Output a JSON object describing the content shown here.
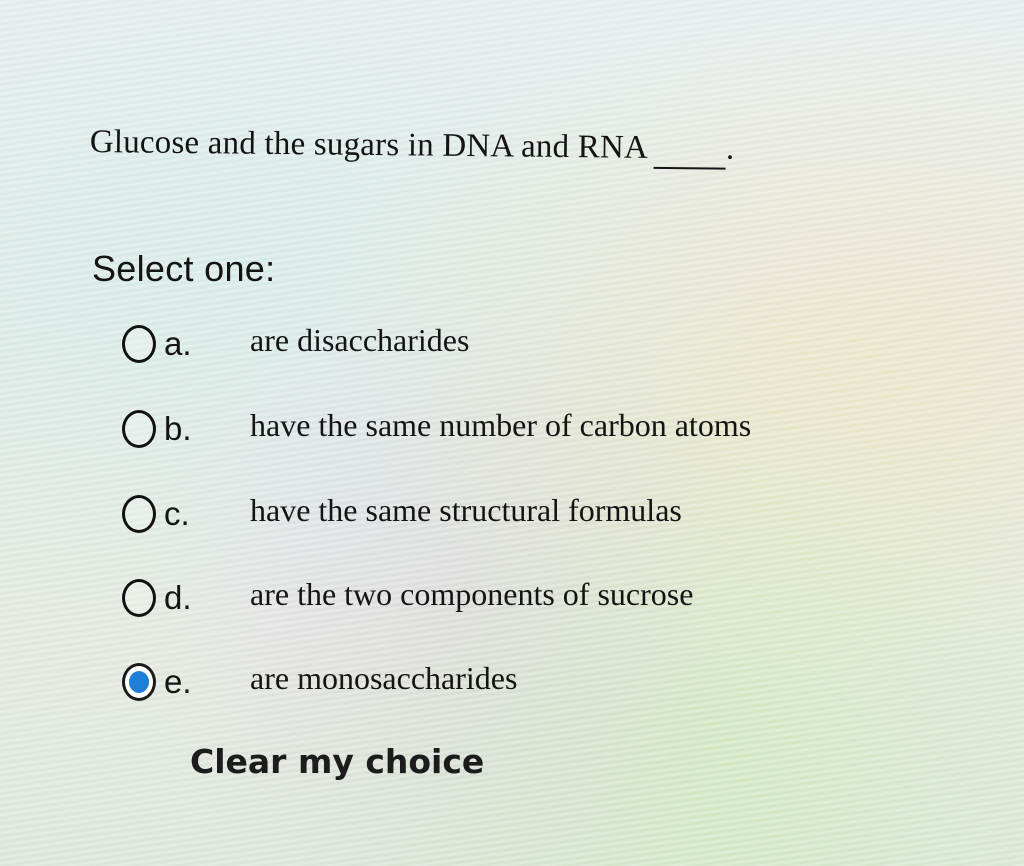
{
  "question": {
    "text": "Glucose and the sugars  in DNA and RNA",
    "suffix": "."
  },
  "prompt": "Select one:",
  "options": [
    {
      "letter": "a.",
      "text": "are disaccharides",
      "selected": false
    },
    {
      "letter": "b.",
      "text": "have the same number of carbon atoms",
      "selected": false
    },
    {
      "letter": "c.",
      "text": "have the same structural formulas",
      "selected": false
    },
    {
      "letter": "d.",
      "text": "are the two components of sucrose",
      "selected": false
    },
    {
      "letter": "e.",
      "text": "are monosaccharides",
      "selected": true
    }
  ],
  "clear_label": "Clear my choice",
  "colors": {
    "accent": "#1f7fd8"
  }
}
